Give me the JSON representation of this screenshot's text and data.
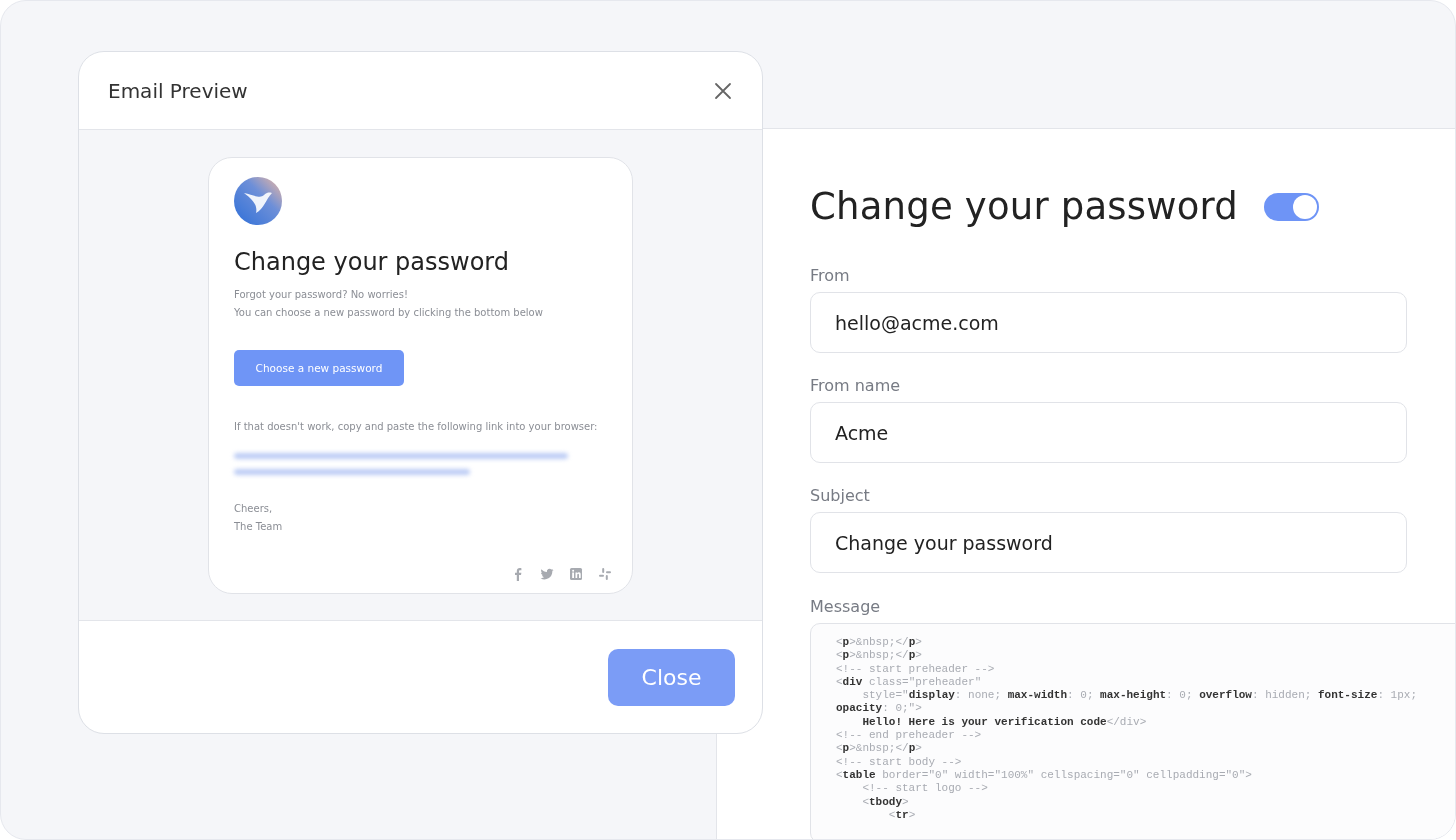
{
  "editor": {
    "title": "Change your password",
    "toggle": {
      "on": true
    },
    "fields": [
      {
        "label": "From",
        "value": "hello@acme.com"
      },
      {
        "label": "From name",
        "value": "Acme"
      },
      {
        "label": "Subject",
        "value": "Change your password"
      }
    ],
    "message": {
      "label": "Message",
      "code_lines": [
        "<**p**>&nbsp;</**p**>",
        "<**p**>&nbsp;</**p**>",
        "<!-- start preheader -->",
        "<**div** class=\"preheader\"",
        "    style=\"**display**: none; **max-width**: 0; **max-height**: 0; **overflow**: hidden; **font-size**: 1px;",
        "**opacity**: 0;\">",
        "    **Hello! Here is your verification code**</div>",
        "<!-- end preheader -->",
        "<**p**>&nbsp;</**p**>",
        "<!-- start body -->",
        "<**table** border=\"0\" width=\"100%\" cellspacing=\"0\" cellpadding=\"0\">",
        "    <!-- start logo -->",
        "    <**tbody**>",
        "        <**tr**>"
      ]
    }
  },
  "modal": {
    "title": "Email Preview",
    "email": {
      "heading": "Change your password",
      "intro": [
        "Forgot your password? No worries!",
        "You can choose a new password by clicking the bottom below"
      ],
      "button": "Choose a new password",
      "fallback": "If that doesn't work, copy and paste the following link into your browser:",
      "signoff": [
        "Cheers,",
        "The Team"
      ]
    },
    "close_button": "Close"
  }
}
